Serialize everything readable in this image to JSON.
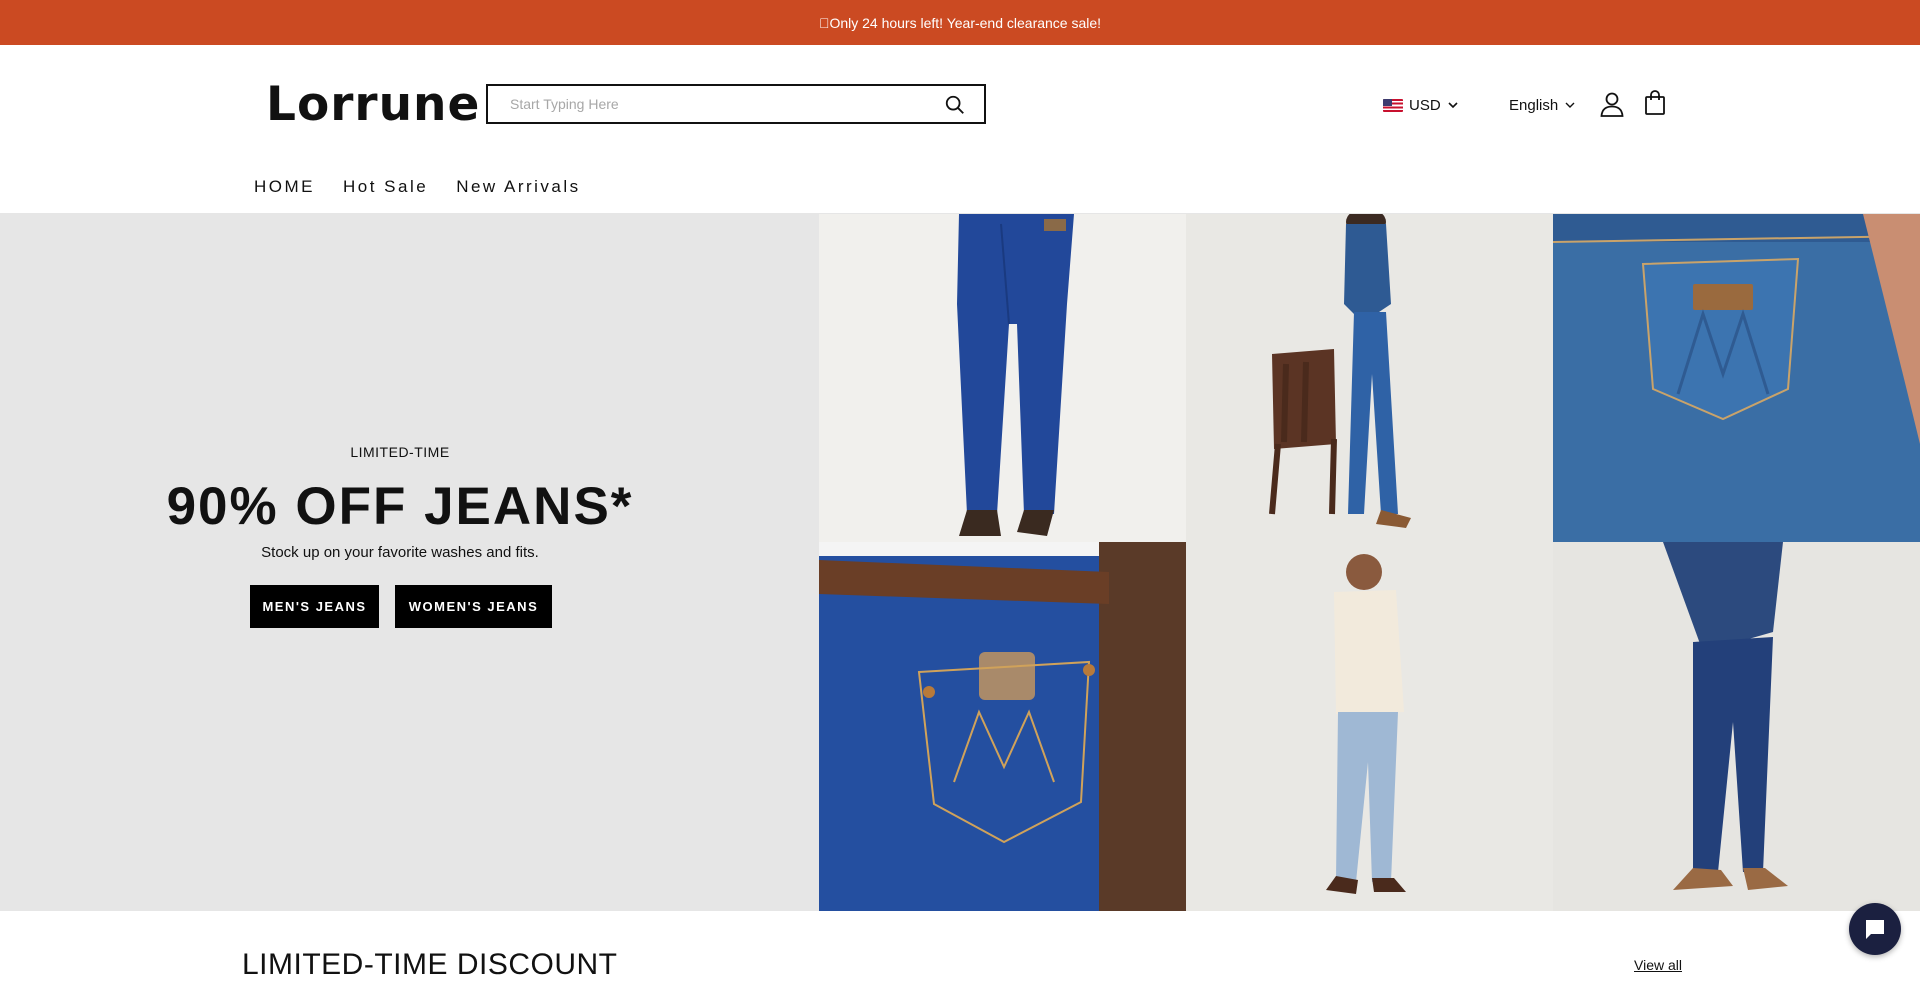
{
  "announcement": {
    "text": "\u0000Only 24 hours left! Year-end clearance sale!"
  },
  "header": {
    "logo": "Lorrune",
    "search": {
      "placeholder": "Start Typing Here",
      "value": ""
    },
    "currency": "USD",
    "language": "English"
  },
  "nav": {
    "items": [
      "HOME",
      "Hot Sale",
      "New Arrivals"
    ]
  },
  "hero": {
    "eyebrow": "LIMITED-TIME",
    "headline": "90% OFF JEANS*",
    "subline": "Stock up on your favorite washes and fits.",
    "buttons": {
      "men": "MEN'S JEANS",
      "women": "WOMEN'S JEANS"
    }
  },
  "section": {
    "title": "LIMITED-TIME DISCOUNT",
    "view_all": "View all"
  },
  "icons": [
    "search-icon",
    "us-flag-icon",
    "chevron-down-icon",
    "account-icon",
    "shopping-bag-icon",
    "chat-icon"
  ],
  "colors": {
    "announcement_bg": "#cb4a22",
    "hero_bg": "#e6e6e6",
    "button_bg": "#000000",
    "denim": "#244fa0",
    "chat_bg": "#1b2040"
  }
}
